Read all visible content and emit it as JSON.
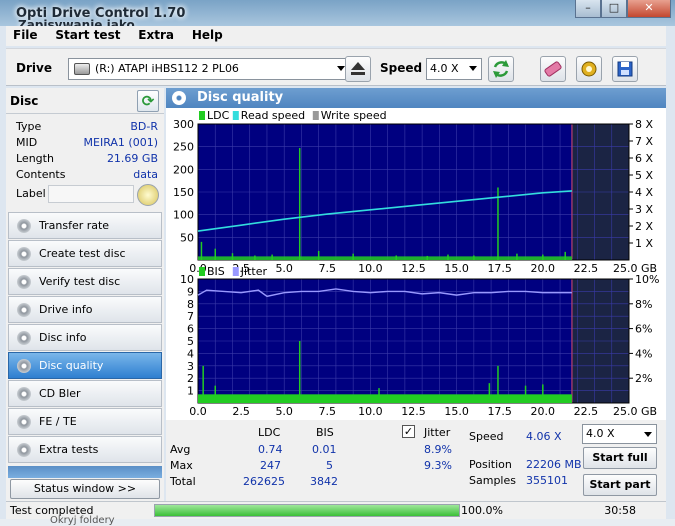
{
  "window": {
    "title": "Opti Drive Control 1.70",
    "title2": "Zapisywanie jako",
    "minimize": "–",
    "maximize": "□",
    "close": "✕"
  },
  "menu": [
    "File",
    "Start test",
    "Extra",
    "Help"
  ],
  "toolbar": {
    "drive_label": "Drive",
    "drive_value": "(R:)  ATAPI iHBS112  2 PL06",
    "speed_label": "Speed",
    "speed_value": "4.0 X"
  },
  "disc": {
    "heading": "Disc",
    "fields": [
      {
        "key": "Type",
        "value": "BD-R"
      },
      {
        "key": "MID",
        "value": "MEIRA1 (001)"
      },
      {
        "key": "Length",
        "value": "21.69 GB"
      },
      {
        "key": "Contents",
        "value": "data"
      }
    ],
    "label_key": "Label",
    "label_value": ""
  },
  "nav": [
    {
      "label": "Transfer rate",
      "active": false
    },
    {
      "label": "Create test disc",
      "active": false
    },
    {
      "label": "Verify test disc",
      "active": false
    },
    {
      "label": "Drive info",
      "active": false
    },
    {
      "label": "Disc info",
      "active": false
    },
    {
      "label": "Disc quality",
      "active": true
    },
    {
      "label": "CD Bler",
      "active": false
    },
    {
      "label": "FE / TE",
      "active": false
    },
    {
      "label": "Extra tests",
      "active": false
    }
  ],
  "status_window_button": "Status window >>",
  "panel_title": "Disc quality",
  "colors": {
    "ldc": "#22cc22",
    "read_speed": "#33dddd",
    "write_speed": "#999999",
    "bis": "#22cc22",
    "jitter": "#9999ff",
    "plot_bg": "#000080",
    "plot_bg_unused": "#1b2444",
    "grid": "#3a3aa8",
    "marker": "#b84070"
  },
  "chart_data": [
    {
      "type": "line",
      "legend": [
        "LDC",
        "Read speed",
        "Write speed"
      ],
      "x_ticks": [
        "0.0",
        "2.5",
        "5.0",
        "7.5",
        "10.0",
        "12.5",
        "15.0",
        "17.5",
        "20.0",
        "22.5",
        "25.0 GB"
      ],
      "xlim": [
        0,
        25
      ],
      "y_left_ticks": [
        "300",
        "250",
        "200",
        "150",
        "100",
        "50"
      ],
      "ylim_left": [
        0,
        300
      ],
      "y_right_ticks": [
        "8 X",
        "7 X",
        "6 X",
        "5 X",
        "4 X",
        "3 X",
        "2 X",
        "1 X"
      ],
      "ylim_right": [
        0,
        8
      ],
      "disc_end": 21.69,
      "read_speed": {
        "x": [
          0,
          2.5,
          5,
          7.5,
          10,
          12.5,
          15,
          17.5,
          20,
          21.69
        ],
        "y": [
          1.7,
          2.05,
          2.4,
          2.7,
          2.95,
          3.2,
          3.45,
          3.7,
          3.95,
          4.06
        ]
      },
      "ldc_baseline": 8,
      "ldc_spikes": [
        {
          "x": 0.2,
          "y": 40
        },
        {
          "x": 1.0,
          "y": 25
        },
        {
          "x": 2.0,
          "y": 15
        },
        {
          "x": 3.3,
          "y": 10
        },
        {
          "x": 4.3,
          "y": 12
        },
        {
          "x": 5.9,
          "y": 247
        },
        {
          "x": 7.0,
          "y": 20
        },
        {
          "x": 9.0,
          "y": 14
        },
        {
          "x": 11.5,
          "y": 10
        },
        {
          "x": 13.3,
          "y": 9
        },
        {
          "x": 14.5,
          "y": 12
        },
        {
          "x": 16.0,
          "y": 10
        },
        {
          "x": 17.4,
          "y": 160
        },
        {
          "x": 18.5,
          "y": 14
        },
        {
          "x": 20.0,
          "y": 12
        },
        {
          "x": 21.3,
          "y": 18
        }
      ]
    },
    {
      "type": "line",
      "legend": [
        "BIS",
        "Jitter"
      ],
      "x_ticks": [
        "0.0",
        "2.5",
        "5.0",
        "7.5",
        "10.0",
        "12.5",
        "15.0",
        "17.5",
        "20.0",
        "22.5",
        "25.0 GB"
      ],
      "xlim": [
        0,
        25
      ],
      "y_left_ticks": [
        "10",
        "9",
        "8",
        "7",
        "6",
        "5",
        "4",
        "3",
        "2",
        "1"
      ],
      "ylim_left": [
        0,
        10
      ],
      "y_right_ticks": [
        "10%",
        "8%",
        "6%",
        "4%",
        "2%"
      ],
      "ylim_right": [
        0,
        10
      ],
      "disc_end": 21.69,
      "jitter": {
        "x": [
          0,
          0.5,
          1.5,
          2.5,
          3.5,
          4.0,
          5.0,
          6.0,
          7.0,
          8.0,
          9.0,
          10.0,
          11.0,
          12.0,
          13.0,
          14.0,
          15.0,
          16.0,
          17.0,
          18.0,
          19.0,
          20.0,
          21.0,
          21.69
        ],
        "y": [
          8.7,
          9.1,
          9.0,
          8.9,
          9.1,
          8.6,
          8.9,
          9.0,
          9.0,
          9.2,
          9.0,
          8.9,
          9.0,
          9.0,
          8.8,
          8.9,
          8.7,
          8.9,
          8.9,
          9.0,
          9.0,
          8.9,
          8.9,
          8.9
        ]
      },
      "bis_baseline": 0.7,
      "bis_spikes": [
        {
          "x": 0.3,
          "y": 3.0
        },
        {
          "x": 1.0,
          "y": 1.4
        },
        {
          "x": 5.9,
          "y": 5.0
        },
        {
          "x": 17.4,
          "y": 3.0
        },
        {
          "x": 16.9,
          "y": 1.6
        },
        {
          "x": 19.0,
          "y": 1.4
        },
        {
          "x": 20.0,
          "y": 1.5
        },
        {
          "x": 10.5,
          "y": 1.2
        }
      ]
    }
  ],
  "stats": {
    "col_ldc": "LDC",
    "col_bis": "BIS",
    "col_jitter": "Jitter",
    "rows": [
      {
        "label": "Avg",
        "ldc": "0.74",
        "bis": "0.01",
        "jitter": "8.9%"
      },
      {
        "label": "Max",
        "ldc": "247",
        "bis": "5",
        "jitter": "9.3%"
      },
      {
        "label": "Total",
        "ldc": "262625",
        "bis": "3842",
        "jitter": ""
      }
    ],
    "speed_label": "Speed",
    "speed_value": "4.06 X",
    "position_label": "Position",
    "position_value": "22206 MB",
    "samples_label": "Samples",
    "samples_value": "355101",
    "speed_select": "4.0 X",
    "start_full": "Start full",
    "start_part": "Start part"
  },
  "statusbar": {
    "text": "Test completed",
    "progress": 1.0,
    "percent": "100.0%",
    "time": "30:58"
  },
  "bottom_text": "Okryj foldery"
}
